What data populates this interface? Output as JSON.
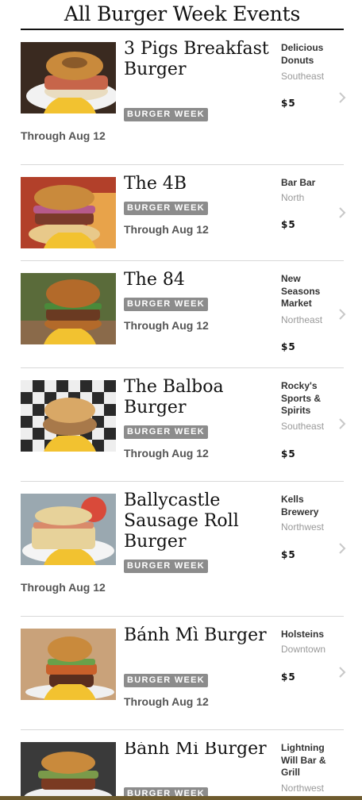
{
  "page": {
    "title": "All Burger Week Events"
  },
  "events": [
    {
      "title": "3 Pigs Breakfast Burger",
      "tag": "BURGER WEEK",
      "date": "Through Aug 12",
      "venue": "Delicious Donuts",
      "area": "Southeast",
      "price": "$5",
      "thumb_colors": {
        "bg": "#3a2a20",
        "bun": "#c98a3c",
        "filling": "#e9dcc0",
        "plate": "#f2f2f2"
      }
    },
    {
      "title": "The 4B",
      "tag": "BURGER WEEK",
      "date": "Through Aug 12",
      "venue": "Bar Bar",
      "area": "North",
      "price": "$5",
      "thumb_colors": {
        "bg": "#b2402a",
        "bun": "#c98a3c",
        "filling": "#7b3a2a",
        "plate": "#e8c98a"
      }
    },
    {
      "title": "The 84",
      "tag": "BURGER WEEK",
      "date": "Through Aug 12",
      "venue": "New Seasons Market",
      "area": "Northeast",
      "price": "$5",
      "thumb_colors": {
        "bg": "#5a6b3a",
        "bun": "#b36a2a",
        "filling": "#6a3a22",
        "plate": "#8a6a4a"
      }
    },
    {
      "title": "The Balboa Burger",
      "tag": "BURGER WEEK",
      "date": "Through Aug 12",
      "venue": "Rocky's Sports & Spirits",
      "area": "Southeast",
      "price": "$5",
      "thumb_colors": {
        "bg": "#2a2a2a",
        "bun": "#d9a866",
        "filling": "#a8794a",
        "plate": "#eeeeee"
      }
    },
    {
      "title": "Ballycastle Sausage Roll Burger",
      "tag": "BURGER WEEK",
      "date": "Through Aug 12",
      "venue": "Kells Brewery",
      "area": "Northwest",
      "price": "$5",
      "thumb_colors": {
        "bg": "#9aa8b0",
        "bun": "#e7d29a",
        "filling": "#d98a6a",
        "plate": "#f4f4f4"
      }
    },
    {
      "title": "Bánh Mì Burger",
      "tag": "BURGER WEEK",
      "date": "Through Aug 12",
      "venue": "Holsteins",
      "area": "Downtown",
      "price": "$5",
      "thumb_colors": {
        "bg": "#c9a27a",
        "bun": "#c98a3c",
        "filling": "#5a2e1e",
        "plate": "#f0f0f0"
      }
    },
    {
      "title": "Bánh Mì Burger",
      "tag": "BURGER WEEK",
      "date": "",
      "venue": "Lightning Will Bar & Grill",
      "area": "Northwest",
      "price": "",
      "thumb_colors": {
        "bg": "#3a3a3a",
        "bun": "#c98a3c",
        "filling": "#7a9a4a",
        "plate": "#f0f0f0"
      }
    }
  ],
  "icons": {
    "badge": "burger-week-badge-icon",
    "chevron": "chevron-right-icon"
  },
  "colors": {
    "tag_bg": "#8c8c8c",
    "muted": "#999999",
    "divider": "#d8d8d8",
    "bottom_rule": "#6e5b2e"
  }
}
